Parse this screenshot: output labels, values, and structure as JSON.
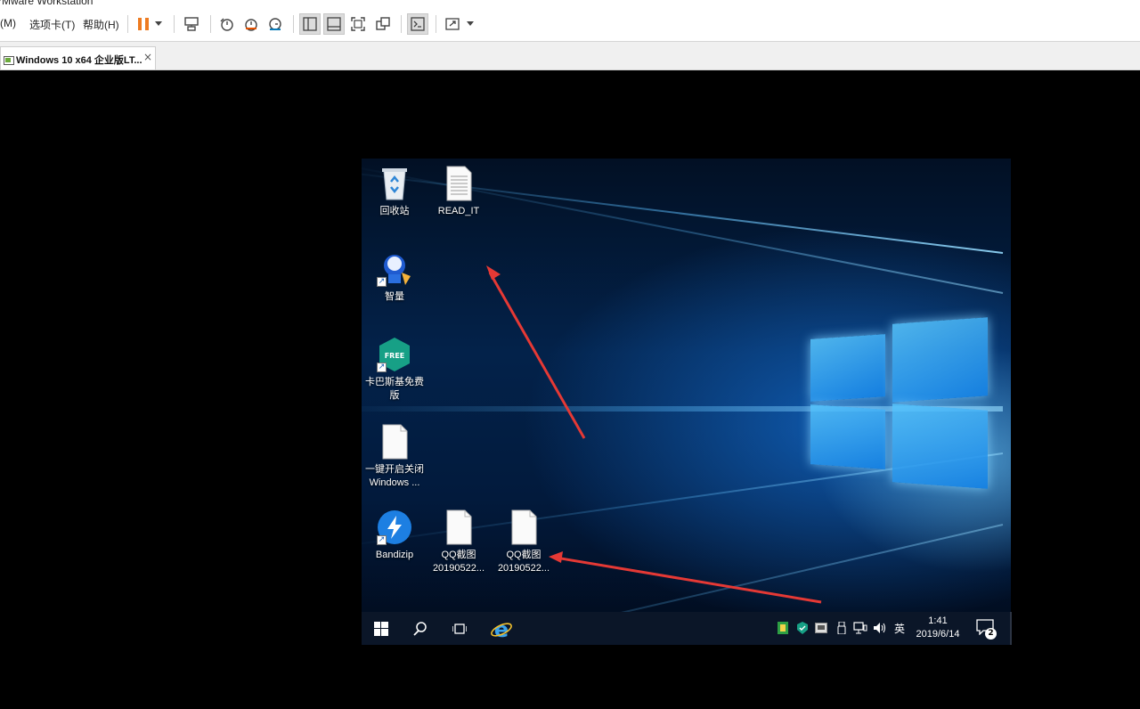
{
  "window": {
    "title": "VMware Workstation"
  },
  "menubar": {
    "items": [
      "(M)",
      "选项卡(T)",
      "帮助(H)"
    ]
  },
  "toolbar": {
    "icons": [
      "pause-icon",
      "dropdown-icon",
      "send-ctrl-alt-del-icon",
      "snapshot-icon",
      "revert-snapshot-icon",
      "manage-snapshots-icon",
      "library-view-icon",
      "thumbnail-view-icon",
      "fullscreen-icon",
      "unity-icon",
      "console-icon",
      "stretch-icon"
    ]
  },
  "tabs": [
    {
      "label": "Windows 10 x64 企业版LT...",
      "close": "×"
    }
  ],
  "desktop": {
    "icons": [
      {
        "label1": "回收站",
        "label2": ""
      },
      {
        "label1": "READ_IT",
        "label2": ""
      },
      {
        "label1": "智量",
        "label2": ""
      },
      {
        "label1": "卡巴斯基免费",
        "label2": "版"
      },
      {
        "label1": "一键开启关闭",
        "label2": "Windows ..."
      },
      {
        "label1": "Bandizip",
        "label2": ""
      },
      {
        "label1": "QQ截图",
        "label2": "20190522..."
      },
      {
        "label1": "QQ截图",
        "label2": "20190522..."
      }
    ]
  },
  "taskbar": {
    "ime": "英",
    "time": "1:41",
    "date": "2019/6/14",
    "notification_count": "2",
    "free_badge": "FREE"
  },
  "colors": {
    "annotation_arrow": "#e53935",
    "taskbar": "#0b1628",
    "pause_orange": "#ee7b21"
  }
}
